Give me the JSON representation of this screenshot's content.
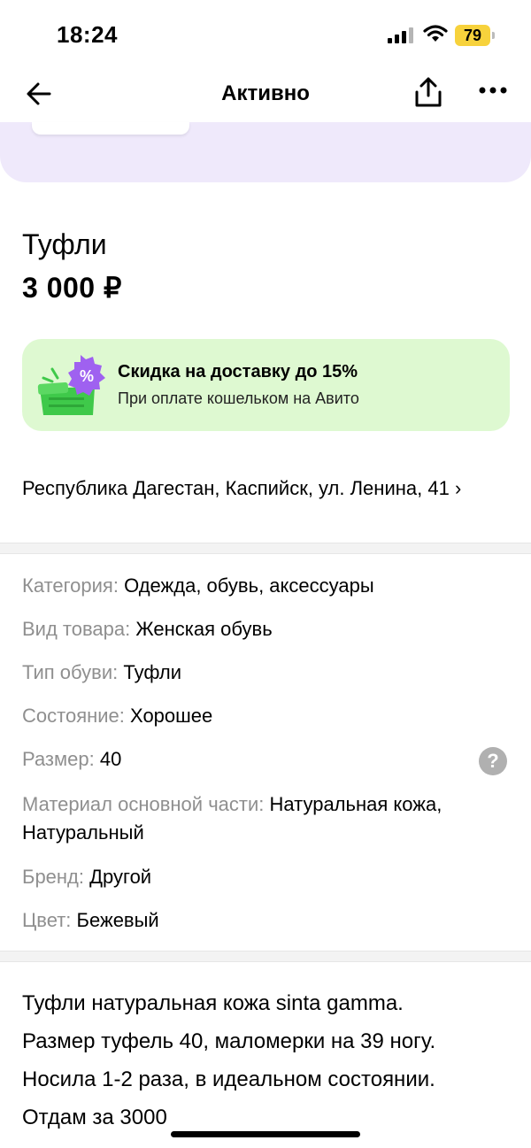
{
  "status": {
    "time": "18:24",
    "battery": "79"
  },
  "nav": {
    "title": "Активно"
  },
  "listing": {
    "title": "Туфли",
    "price": "3 000 ₽"
  },
  "promo": {
    "title": "Скидка на доставку до 15%",
    "subtitle": "При оплате кошельком на Авито"
  },
  "address": {
    "text": "Республика Дагестан, Каспийск, ул. Ленина, 41",
    "chevron": "›"
  },
  "params": [
    {
      "label": "Категория:",
      "value": "Одежда, обувь, аксессуары"
    },
    {
      "label": "Вид товара:",
      "value": "Женская обувь"
    },
    {
      "label": "Тип обуви:",
      "value": "Туфли"
    },
    {
      "label": "Состояние:",
      "value": "Хорошее"
    },
    {
      "label": "Размер:",
      "value": "40"
    },
    {
      "label": "Материал основной части:",
      "value": "Натуральная кожа, Натуральный"
    },
    {
      "label": "Бренд:",
      "value": "Другой"
    },
    {
      "label": "Цвет:",
      "value": "Бежевый"
    }
  ],
  "help": {
    "icon": "question-icon",
    "symbol": "?"
  },
  "description": {
    "lines": [
      "Туфли натуральная кожа sinta gamma.",
      "Размер туфель 40, маломерки на 39 ногу.",
      "Носила 1-2 раза, в идеальном состоянии.",
      "Отдам за 3000"
    ]
  },
  "colors": {
    "promo_bg": "#def9d1",
    "gallery_bg": "#efe9fb",
    "battery": "#f7d23c",
    "label_gray": "#8f8f8f"
  }
}
